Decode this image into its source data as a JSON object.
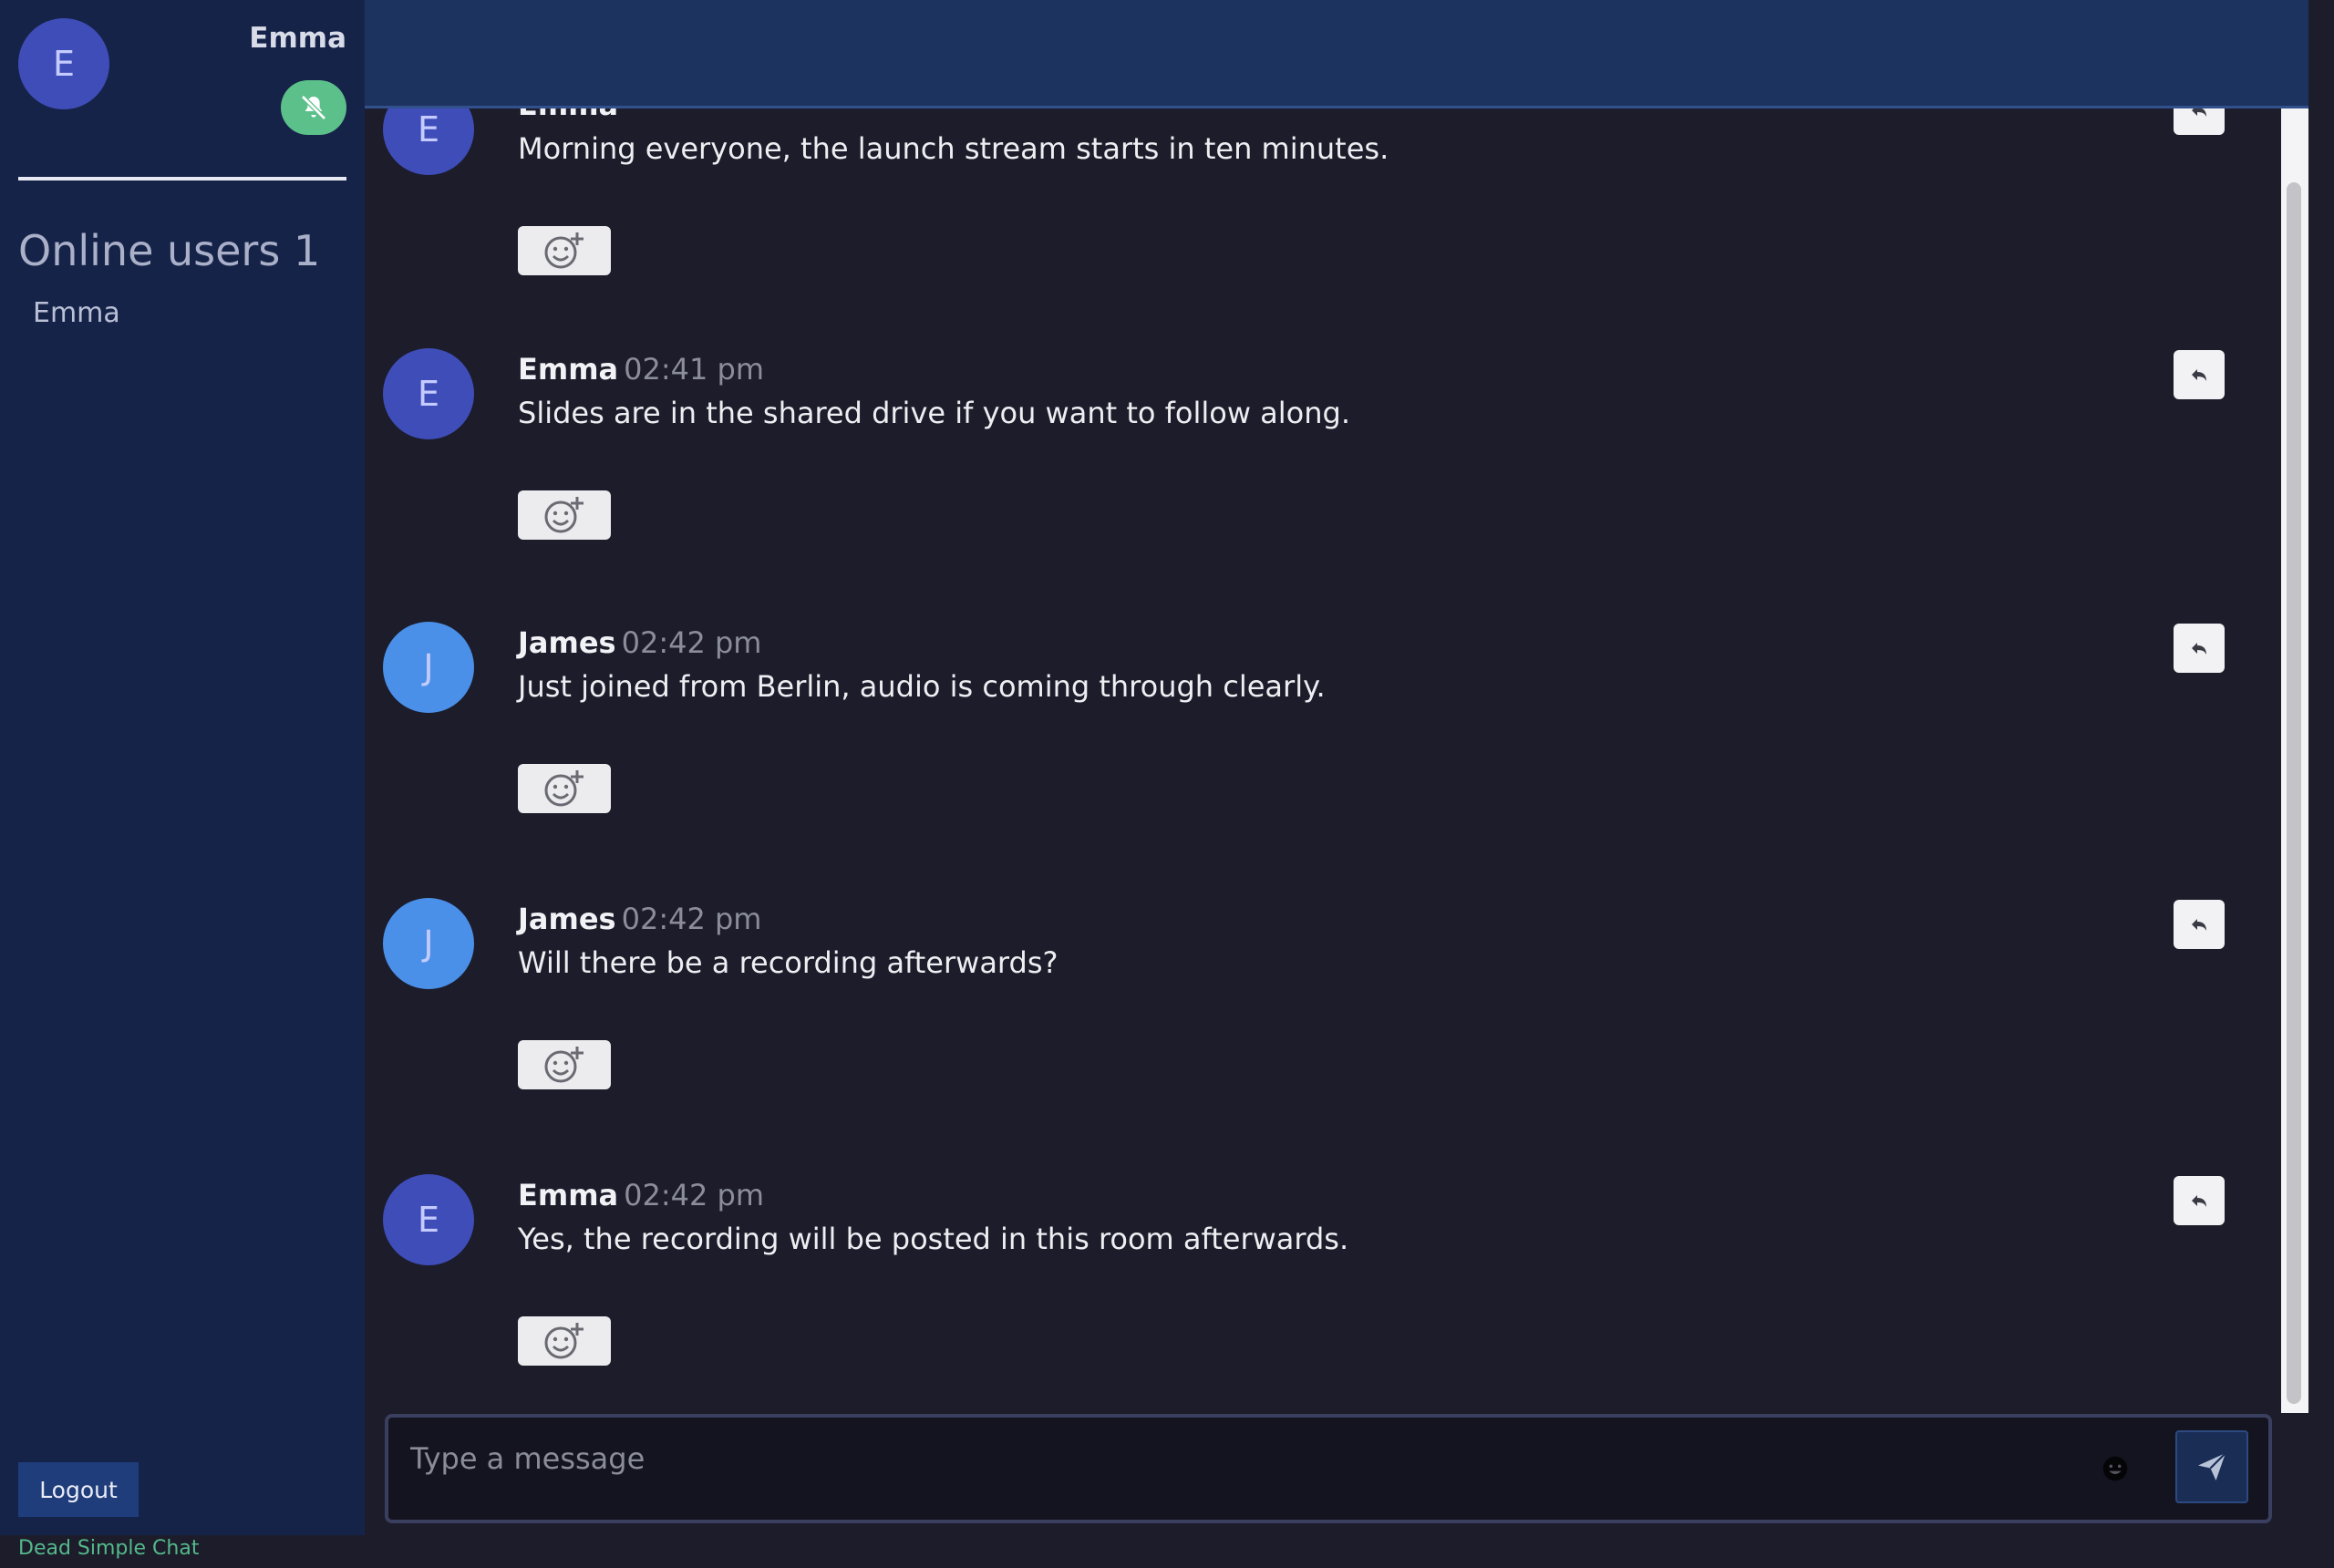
{
  "sidebar": {
    "current_user": {
      "name": "Emma",
      "initial": "E"
    },
    "online_title": "Online users",
    "online_count": "1",
    "online_users": [
      "Emma"
    ],
    "logout_label": "Logout",
    "brand": "Dead Simple Chat"
  },
  "messages": [
    {
      "author": "Emma",
      "initial": "E",
      "time": "",
      "text": "Morning everyone, the launch stream starts in ten minutes.",
      "avatar_color": "#3f4db8"
    },
    {
      "author": "Emma",
      "initial": "E",
      "time": "02:41 pm",
      "text": "Slides are in the shared drive if you want to follow along.",
      "avatar_color": "#3f4db8"
    },
    {
      "author": "James",
      "initial": "J",
      "time": "02:42 pm",
      "text": "Just joined from Berlin, audio is coming through clearly.",
      "avatar_color": "#4a90e8"
    },
    {
      "author": "James",
      "initial": "J",
      "time": "02:42 pm",
      "text": "Will there be a recording afterwards?",
      "avatar_color": "#4a90e8"
    },
    {
      "author": "Emma",
      "initial": "E",
      "time": "02:42 pm",
      "text": "Yes, the recording will be posted in this room afterwards.",
      "avatar_color": "#3f4db8"
    }
  ],
  "composer": {
    "placeholder": "Type a message"
  },
  "icons": {
    "mute": "bell-slash-icon",
    "reaction": "add-reaction-icon",
    "reply": "reply-icon",
    "emoji": "emoji-icon",
    "send": "send-icon"
  },
  "colors": {
    "sidebar_bg": "#162349",
    "chat_bg": "#1c1c2b",
    "header_bg": "#1c3360",
    "mute_toggle": "#5cc08a",
    "brand_text": "#54b98a"
  }
}
